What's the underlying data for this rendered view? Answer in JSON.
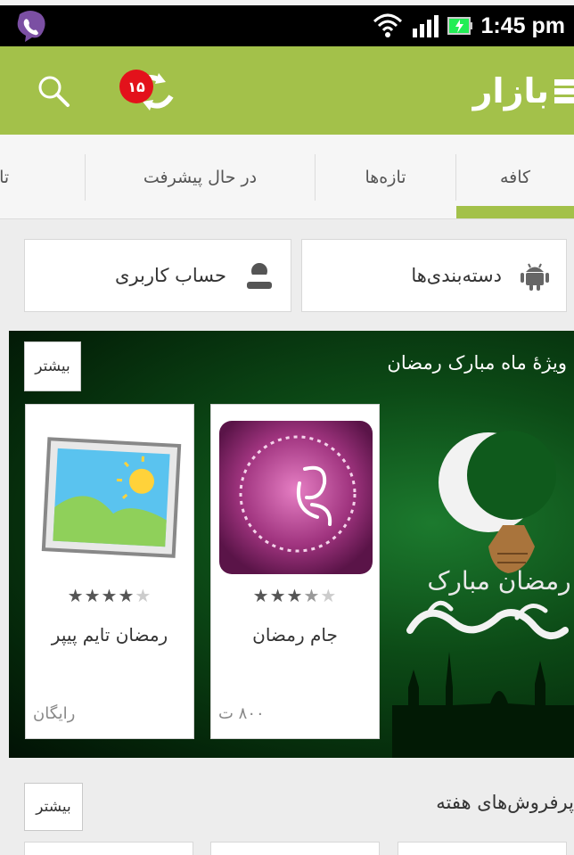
{
  "status_bar": {
    "time": "1:45 pm"
  },
  "action_bar": {
    "brand": "بازار",
    "notification_count": "۱۵"
  },
  "tabs": [
    {
      "label": "کافه",
      "active": true
    },
    {
      "label": "تازه‌ها",
      "active": false
    },
    {
      "label": "در حال پیشرفت",
      "active": false
    },
    {
      "label": "تازه",
      "active": false
    }
  ],
  "quick_buttons": {
    "categories": "دسته‌بندی‌ها",
    "account": "حساب کاربری"
  },
  "featured": {
    "title": "ویژهٔ ماه مبارک رمضان",
    "more_label": "بیشتر",
    "apps": [
      {
        "name": "جام رمضان",
        "price": "۸۰۰ ت",
        "rating": 3.5,
        "icon": "calligraphy-icon"
      },
      {
        "name": "رمضان تایم پیپر",
        "price": "رایگان",
        "rating": 4,
        "icon": "picture-frame-icon"
      }
    ],
    "art_text": "رمضان مبارک"
  },
  "bestsellers": {
    "title": "پرفروش‌های هفته",
    "more_label": "بیشتر"
  },
  "colors": {
    "brand_green": "#a3c14a",
    "badge_red": "#e3121b"
  }
}
